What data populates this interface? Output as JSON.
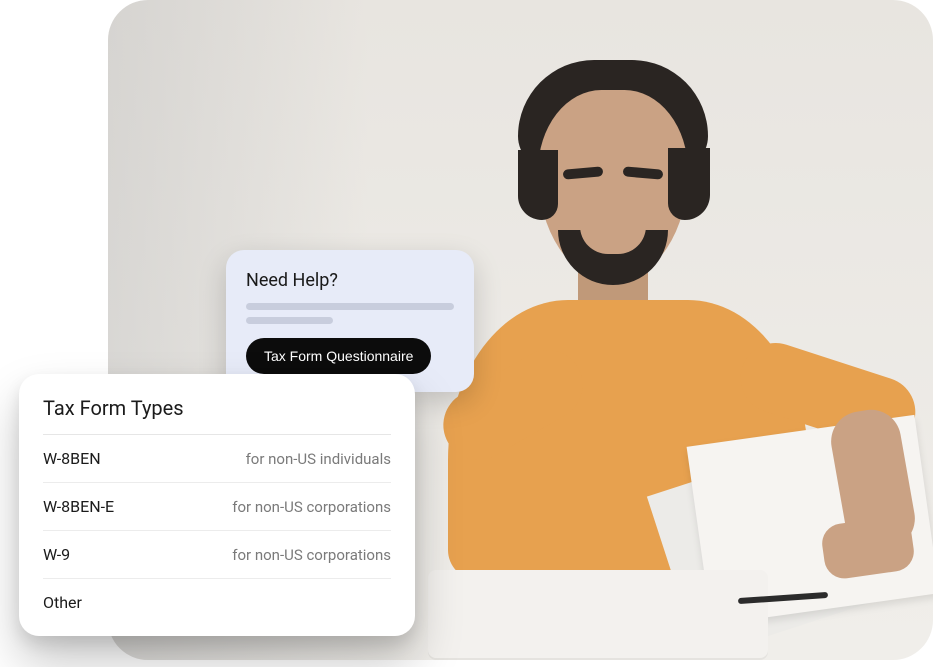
{
  "help_card": {
    "title": "Need Help?",
    "cta_label": "Tax Form Questionnaire"
  },
  "tax_card": {
    "title": "Tax Form Types",
    "rows": [
      {
        "code": "W-8BEN",
        "desc": "for non-US individuals"
      },
      {
        "code": "W-8BEN-E",
        "desc": "for non-US corporations"
      },
      {
        "code": "W-9",
        "desc": "for non-US corporations"
      },
      {
        "code": "Other",
        "desc": ""
      }
    ]
  }
}
